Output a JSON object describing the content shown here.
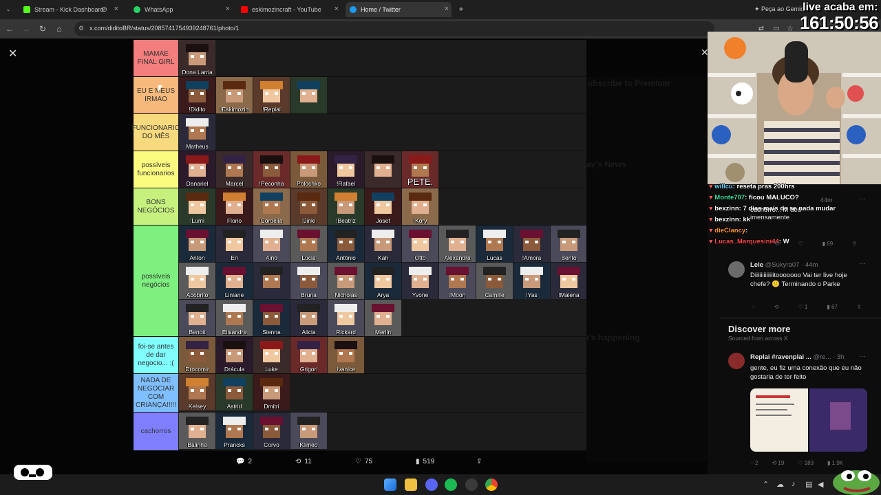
{
  "tabs": [
    {
      "label": "Stream - Kick Dashboard",
      "color": "#53fc18"
    },
    {
      "label": "WhatsApp",
      "color": "#25d366"
    },
    {
      "label": "eskimozincraft - YouTube",
      "color": "#ff0000"
    },
    {
      "label": "Home / Twitter",
      "color": "#1d9bf0"
    }
  ],
  "gemini": "Peça ao Gemini",
  "url": "x.com/diditoBR/status/2085741754939248761/photo/1",
  "stream_overlay": {
    "label": "live acaba em:",
    "countdown": "161:50:56"
  },
  "tiers": [
    {
      "label": "MAMAE FINAL GIRL",
      "color": "#f47d7d",
      "items": [
        "Dona Larria"
      ]
    },
    {
      "label": "EU E MEUS IRMAO",
      "color": "#f6b97b",
      "items": [
        "!Didito",
        "!Eskimozin",
        "!Replai",
        ""
      ]
    },
    {
      "label": "FUNCIONARIO DO MÊS",
      "color": "#f8da7e",
      "items": [
        "Matheus"
      ]
    },
    {
      "label": "possíveis funcionarios",
      "color": "#fbfb80",
      "items": [
        "Danariel",
        "Marcel",
        "!Peconha",
        "Polochko",
        "!Rafael",
        "",
        "PETE."
      ]
    },
    {
      "label": "BONS NEGÓCIOS",
      "color": "#c6f17f",
      "items": [
        "!Lumi",
        "Florio",
        "Cordelia",
        "!Jinki",
        "!Beatriz",
        "Josef",
        "!Kory"
      ]
    },
    {
      "label": "possíveis negócios",
      "color": "#7ef07f",
      "items": [
        "Anton",
        "Eri",
        "Aino",
        "Lúcia",
        "Antônio",
        "Kah",
        "Otto",
        "Alexandra",
        "Lucas",
        "!Amora",
        "Bento",
        "Abobrito",
        "Liniane",
        "",
        "Bruna",
        "Nicholas",
        "Arya",
        "Yvone",
        "!Moon",
        "Camille",
        "!Yas",
        "!Malena",
        "Benoit",
        "Elisandre",
        "Sienna",
        "Alicia",
        "Rickard",
        "Merlin"
      ]
    },
    {
      "label": "foi-se antes de dar negocio... :(",
      "color": "#80fefe",
      "items": [
        "Drocomir",
        "Drácula",
        "Luke",
        "Grigori",
        "Ivanice"
      ]
    },
    {
      "label": "NADA DE NEGOCIAR COM CRIANÇA!!!!!",
      "color": "#7fbffe",
      "items": [
        "Kelsey",
        "Astrid",
        "Dmitri"
      ]
    },
    {
      "label": "cachorros",
      "color": "#7f7ffe",
      "items": [
        "Balinha",
        "Prancks",
        "Corvo",
        "Klimeo"
      ]
    }
  ],
  "post_actions": {
    "replies": "2",
    "reposts": "11",
    "likes": "75",
    "views": "519"
  },
  "chat": [
    {
      "user": "willcu",
      "color": "#6fd2ff",
      "text": "reseta pras 200hrs"
    },
    {
      "user": "Monte707",
      "color": "#40e0a0",
      "text": "ficou MALUCO?"
    },
    {
      "user": "bexzinn",
      "color": "#ffffff",
      "text": "7 dias mais de se nada mudar"
    },
    {
      "user": "bexzinn",
      "color": "#ffffff",
      "text": "kk"
    },
    {
      "user": "dieClancy",
      "color": "#ff9a2e",
      "text": ""
    },
    {
      "user": "Lucas_Marquesini44",
      "color": "#ff4a4a",
      "text": "W"
    }
  ],
  "replies": [
    {
      "time": "44m",
      "text": "cachorro... M deu imensamente",
      "metrics": [
        "",
        "",
        "",
        "69",
        ""
      ]
    },
    {
      "author": "Lele",
      "handle": "@Sukyra07",
      "time": "44m",
      "text": "Diiiiiiiiiiiiitooooooo Vai ter live hoje chefe? 😕 Terminando o Parke",
      "metrics": [
        "",
        "",
        "1",
        "67",
        ""
      ]
    }
  ],
  "discover": {
    "title": "Discover more",
    "subtitle": "Sourced from across X",
    "post": {
      "author": "Replai #ravenplai ...",
      "handle": "@re...",
      "time": "3h",
      "text": "gente, eu fiz uma conexão que eu não gostaria de ter feito",
      "metrics": [
        "2",
        "19",
        "183",
        "1.9K",
        ""
      ]
    }
  },
  "faded_sidebar": [
    "ubscribe to Premium",
    "ay's News",
    "t's happening"
  ]
}
